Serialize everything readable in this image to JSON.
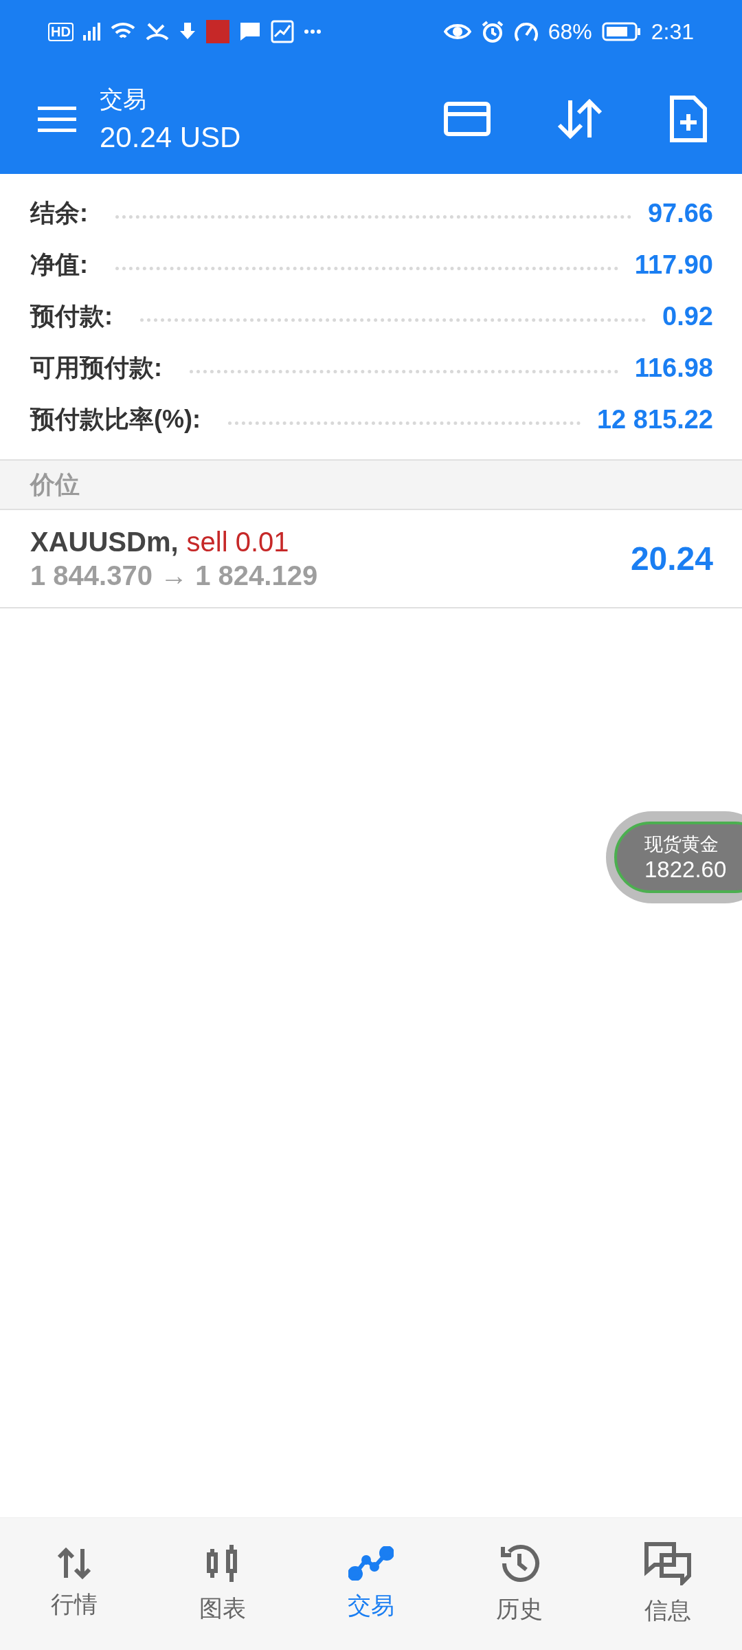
{
  "status_bar": {
    "network": "HD",
    "battery": "68%",
    "time": "2:31"
  },
  "header": {
    "title": "交易",
    "subtitle": "20.24 USD"
  },
  "summary": [
    {
      "label": "结余:",
      "value": "97.66"
    },
    {
      "label": "净值:",
      "value": "117.90"
    },
    {
      "label": "预付款:",
      "value": "0.92"
    },
    {
      "label": "可用预付款:",
      "value": "116.98"
    },
    {
      "label": "预付款比率(%):",
      "value": "12 815.22"
    }
  ],
  "section": {
    "title": "价位"
  },
  "positions": [
    {
      "symbol": "XAUUSDm,",
      "order": "sell 0.01",
      "kind": "sell",
      "prices": "1 844.370 → 1 824.129",
      "profit": "20.24"
    }
  ],
  "floating_widget": {
    "name": "现货黄金",
    "price": "1822.60"
  },
  "bottom_nav": [
    {
      "label": "行情",
      "selected": false
    },
    {
      "label": "图表",
      "selected": false
    },
    {
      "label": "交易",
      "selected": true
    },
    {
      "label": "历史",
      "selected": false
    },
    {
      "label": "信息",
      "selected": false
    }
  ]
}
